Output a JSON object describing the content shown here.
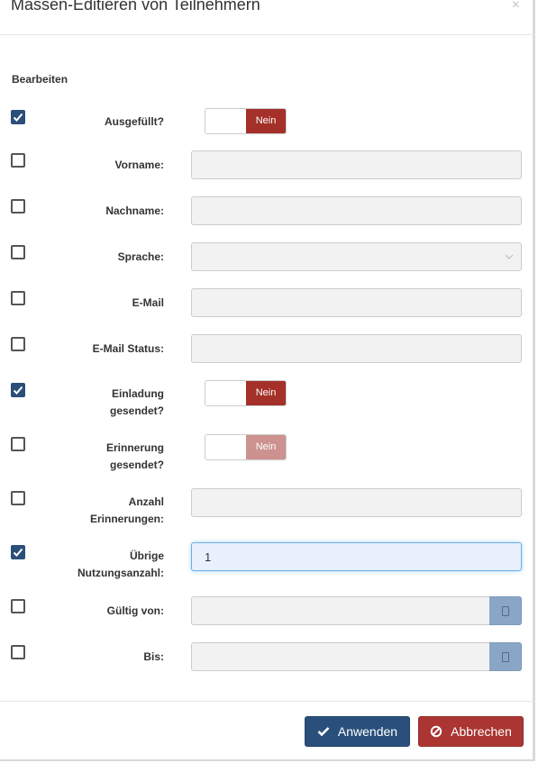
{
  "modal": {
    "title": "Massen-Editieren von Teilnehmern",
    "close_glyph": "×",
    "section_label": "Bearbeiten"
  },
  "fields": {
    "ausgefuellt": {
      "label": "Ausgefüllt?",
      "checked": true,
      "toggle_value": "Nein"
    },
    "vorname": {
      "label": "Vorname:",
      "checked": false,
      "value": ""
    },
    "nachname": {
      "label": "Nachname:",
      "checked": false,
      "value": ""
    },
    "sprache": {
      "label": "Sprache:",
      "checked": false,
      "value": ""
    },
    "email": {
      "label": "E-Mail",
      "checked": false,
      "value": ""
    },
    "email_status": {
      "label": "E-Mail Status:",
      "checked": false,
      "value": ""
    },
    "einladung": {
      "label_line1": "Einladung",
      "label_line2": "gesendet?",
      "checked": true,
      "toggle_value": "Nein"
    },
    "erinnerung": {
      "label_line1": "Erinnerung",
      "label_line2": "gesendet?",
      "checked": false,
      "toggle_value": "Nein"
    },
    "anzahl_erinnerungen": {
      "label_line1": "Anzahl",
      "label_line2": "Erinnerungen:",
      "checked": false,
      "value": ""
    },
    "uebrige_nutzungsanzahl": {
      "label_line1": "Übrige",
      "label_line2": "Nutzungsanzahl:",
      "checked": true,
      "value": "1"
    },
    "gueltig_von": {
      "label": "Gültig von:",
      "checked": false,
      "value": ""
    },
    "bis": {
      "label": "Bis:",
      "checked": false,
      "value": ""
    }
  },
  "footer": {
    "apply_label": "Anwenden",
    "cancel_label": "Abbrechen"
  },
  "colors": {
    "primary": "#2a4f7b",
    "danger": "#aa3532",
    "toggle_off": "#a43029",
    "toggle_off_disabled": "#cd9290",
    "checkbox_checked": "#2b4f7a",
    "calendar_button": "#8aa6c6"
  },
  "icons": {
    "apply": "check-icon",
    "cancel": "ban-icon",
    "close": "close-icon",
    "select": "chevron-down-icon",
    "date": "calendar-icon",
    "checkbox": "checkmark-icon"
  }
}
